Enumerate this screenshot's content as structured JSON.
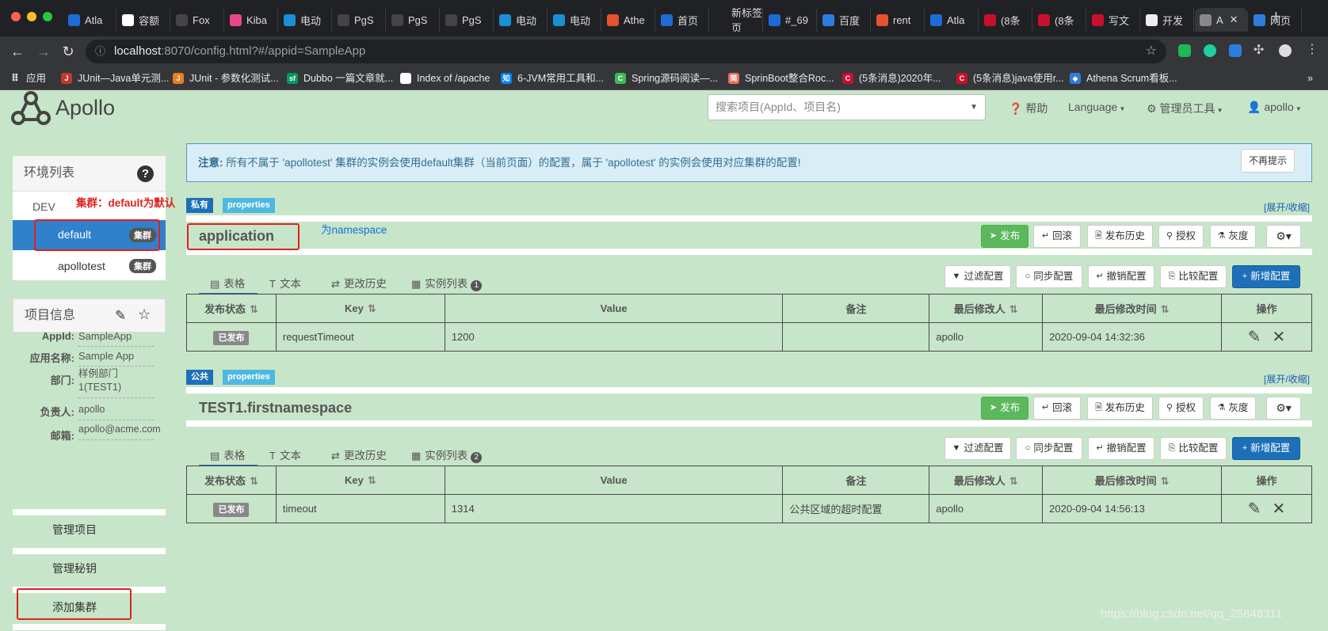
{
  "browser": {
    "tabs": [
      "Atla",
      "容额",
      "Fox",
      "Kiba",
      "电动",
      "PgS",
      "PgS",
      "PgS",
      "电动",
      "电动",
      "Athe",
      "首页",
      "新标签页",
      "#_69",
      "百度",
      "rent",
      "Atla",
      "(8条",
      "(8条",
      "写文",
      "开发",
      "A",
      "网页"
    ],
    "tab_icon_colors": [
      "#1e6bd6",
      "#fff",
      "#444",
      "#e8478b",
      "#1a8fd6",
      "#444",
      "#444",
      "#444",
      "#1a8fd6",
      "#1a8fd6",
      "#e5532d",
      "#1e6bd6",
      "#202124",
      "#1e6bd6",
      "#2d7de0",
      "#e5532d",
      "#1e6bd6",
      "#c8102e",
      "#c8102e",
      "#c8102e",
      "#eee",
      "#888",
      "#2d7de0"
    ],
    "url_host": "localhost",
    "url_path": ":8070/config.html?#/appid=SampleApp",
    "bookmarks": [
      "应用",
      "JUnit—Java单元测...",
      "JUnit - 参数化测试...",
      "Dubbo 一篇文章就...",
      "Index of /apache",
      "6-JVM常用工具和...",
      "Spring源码阅读—...",
      "SprinBoot整合Roc...",
      "(5条消息)2020年...",
      "(5条消息)java使用r...",
      "Athena Scrum看板..."
    ],
    "bookmark_icons": [
      "",
      "J",
      "J",
      "sf",
      "",
      "知",
      "C",
      "简",
      "C",
      "C",
      "◆"
    ],
    "bookmark_colors": [
      "",
      "#c0392b",
      "#e67e22",
      "#009a61",
      "#fff",
      "#0084ff",
      "#3cba54",
      "#ea6f5a",
      "#c8102e",
      "#c8102e",
      "#2d7de0"
    ],
    "more": "»"
  },
  "header": {
    "logo": "Apollo",
    "search_placeholder": "搜索项目(AppId、项目名)",
    "help": "帮助",
    "language": "Language",
    "admin_tools": "管理员工具",
    "user": "apollo"
  },
  "sidebar": {
    "env_title": "环境列表",
    "env": "DEV",
    "clusters": [
      {
        "name": "default",
        "badge": "集群"
      },
      {
        "name": "apollotest",
        "badge": "集群"
      }
    ],
    "info_title": "项目信息",
    "info": [
      {
        "label": "AppId:",
        "value": "SampleApp"
      },
      {
        "label": "应用名称:",
        "value": "Sample App"
      },
      {
        "label": "部门:",
        "value": "样例部门1(TEST1)"
      },
      {
        "label": "负责人:",
        "value": "apollo"
      },
      {
        "label": "邮箱:",
        "value": "apollo@acme.com"
      }
    ],
    "menu": [
      "管理项目",
      "管理秘钥",
      "添加集群"
    ]
  },
  "notice": {
    "prefix": "注意:",
    "text": "所有不属于 'apollotest' 集群的实例会使用default集群（当前页面）的配置，属于 'apollotest' 的实例会使用对应集群的配置!",
    "dismiss": "不再提示"
  },
  "annotations": {
    "cluster": "集群：default为默认",
    "namespace": "为namespace"
  },
  "namespaces": [
    {
      "scope": "私有",
      "scope_color": "#1d6fb8",
      "format": "properties",
      "title": "application",
      "instance_count": "1",
      "rows": [
        {
          "status": "已发布",
          "key": "requestTimeout",
          "value": "1200",
          "comment": "",
          "modifier": "apollo",
          "time": "2020-09-04 14:32:36"
        }
      ]
    },
    {
      "scope": "公共",
      "scope_color": "#1d6fb8",
      "format": "properties",
      "title": "TEST1.firstnamespace",
      "instance_count": "2",
      "rows": [
        {
          "status": "已发布",
          "key": "timeout",
          "value": "1314",
          "comment": "公共区域的超时配置",
          "modifier": "apollo",
          "time": "2020-09-04 14:56:13"
        }
      ]
    }
  ],
  "ns_common": {
    "expand": "[展开/收缩]",
    "buttons": [
      "发布",
      "回滚",
      "发布历史",
      "授权",
      "灰度"
    ],
    "tabs": [
      "表格",
      "文本",
      "更改历史",
      "实例列表"
    ],
    "actions": [
      "过滤配置",
      "同步配置",
      "撤销配置",
      "比较配置",
      "新增配置"
    ],
    "columns": [
      "发布状态",
      "Key",
      "Value",
      "备注",
      "最后修改人",
      "最后修改时间",
      "操作"
    ]
  },
  "watermark": "https://blog.csdn.net/qq_25848311"
}
